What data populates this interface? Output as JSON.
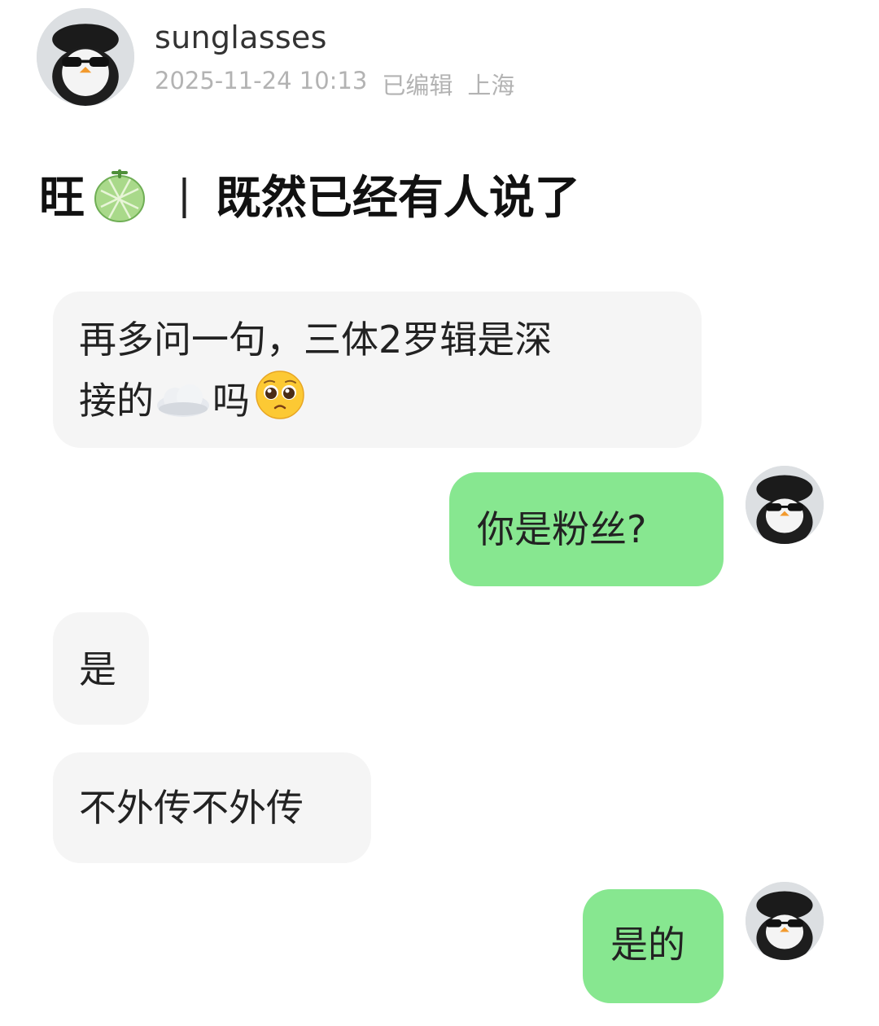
{
  "post": {
    "username": "sunglasses",
    "timestamp": "2025-11-24 10:13",
    "edited": "已编辑",
    "location": "上海",
    "title_prefix": "旺",
    "title_emoji": "melon-emoji",
    "title_separator": "|",
    "title_text": "既然已经有人说了"
  },
  "chat": {
    "messages": [
      {
        "side": "left",
        "line1": "再多问一句，三体2罗辑是深",
        "line2_before": "接的",
        "emoji_cloud": "cloud-emoji",
        "line2_after": "吗",
        "emoji_face": "pleading-face-emoji"
      },
      {
        "side": "right",
        "text": "你是粉丝?"
      },
      {
        "side": "left",
        "text": "是"
      },
      {
        "side": "left",
        "text": "不外传不外传"
      },
      {
        "side": "right",
        "text": "是的"
      }
    ]
  },
  "colors": {
    "left_bubble": "#f5f5f5",
    "right_bubble": "#87e790",
    "meta_text": "#b3b3b3"
  }
}
